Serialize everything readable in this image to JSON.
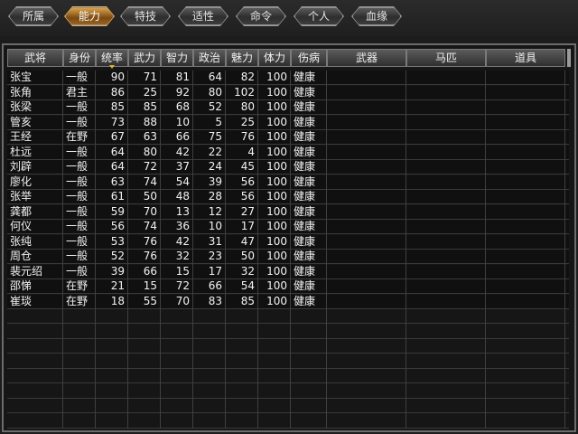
{
  "tabs": [
    {
      "label": "所属",
      "active": false
    },
    {
      "label": "能力",
      "active": true
    },
    {
      "label": "特技",
      "active": false
    },
    {
      "label": "适性",
      "active": false
    },
    {
      "label": "命令",
      "active": false
    },
    {
      "label": "个人",
      "active": false
    },
    {
      "label": "血缘",
      "active": false
    }
  ],
  "columns": [
    "武将",
    "身份",
    "统率",
    "武力",
    "智力",
    "政治",
    "魅力",
    "体力",
    "伤病",
    "武器",
    "马匹",
    "道具"
  ],
  "sorted_column": "统率",
  "rows": [
    [
      "张宝",
      "一般",
      "90",
      "71",
      "81",
      "64",
      "82",
      "100",
      "健康"
    ],
    [
      "张角",
      "君主",
      "86",
      "25",
      "92",
      "80",
      "102",
      "100",
      "健康"
    ],
    [
      "张梁",
      "一般",
      "85",
      "85",
      "68",
      "52",
      "80",
      "100",
      "健康"
    ],
    [
      "管亥",
      "一般",
      "73",
      "88",
      "10",
      "5",
      "25",
      "100",
      "健康"
    ],
    [
      "王经",
      "在野",
      "67",
      "63",
      "66",
      "75",
      "76",
      "100",
      "健康"
    ],
    [
      "杜远",
      "一般",
      "64",
      "80",
      "42",
      "22",
      "4",
      "100",
      "健康"
    ],
    [
      "刘辟",
      "一般",
      "64",
      "72",
      "37",
      "24",
      "45",
      "100",
      "健康"
    ],
    [
      "廖化",
      "一般",
      "63",
      "74",
      "54",
      "39",
      "56",
      "100",
      "健康"
    ],
    [
      "张举",
      "一般",
      "61",
      "50",
      "48",
      "28",
      "56",
      "100",
      "健康"
    ],
    [
      "龚都",
      "一般",
      "59",
      "70",
      "13",
      "12",
      "27",
      "100",
      "健康"
    ],
    [
      "何仪",
      "一般",
      "56",
      "74",
      "36",
      "10",
      "17",
      "100",
      "健康"
    ],
    [
      "张纯",
      "一般",
      "53",
      "76",
      "42",
      "31",
      "47",
      "100",
      "健康"
    ],
    [
      "周仓",
      "一般",
      "52",
      "76",
      "32",
      "23",
      "50",
      "100",
      "健康"
    ],
    [
      "裴元绍",
      "一般",
      "39",
      "66",
      "15",
      "17",
      "32",
      "100",
      "健康"
    ],
    [
      "邵悌",
      "在野",
      "21",
      "15",
      "72",
      "66",
      "54",
      "100",
      "健康"
    ],
    [
      "崔琰",
      "在野",
      "18",
      "55",
      "70",
      "83",
      "85",
      "100",
      "健康"
    ]
  ],
  "empty_row_count": 8
}
